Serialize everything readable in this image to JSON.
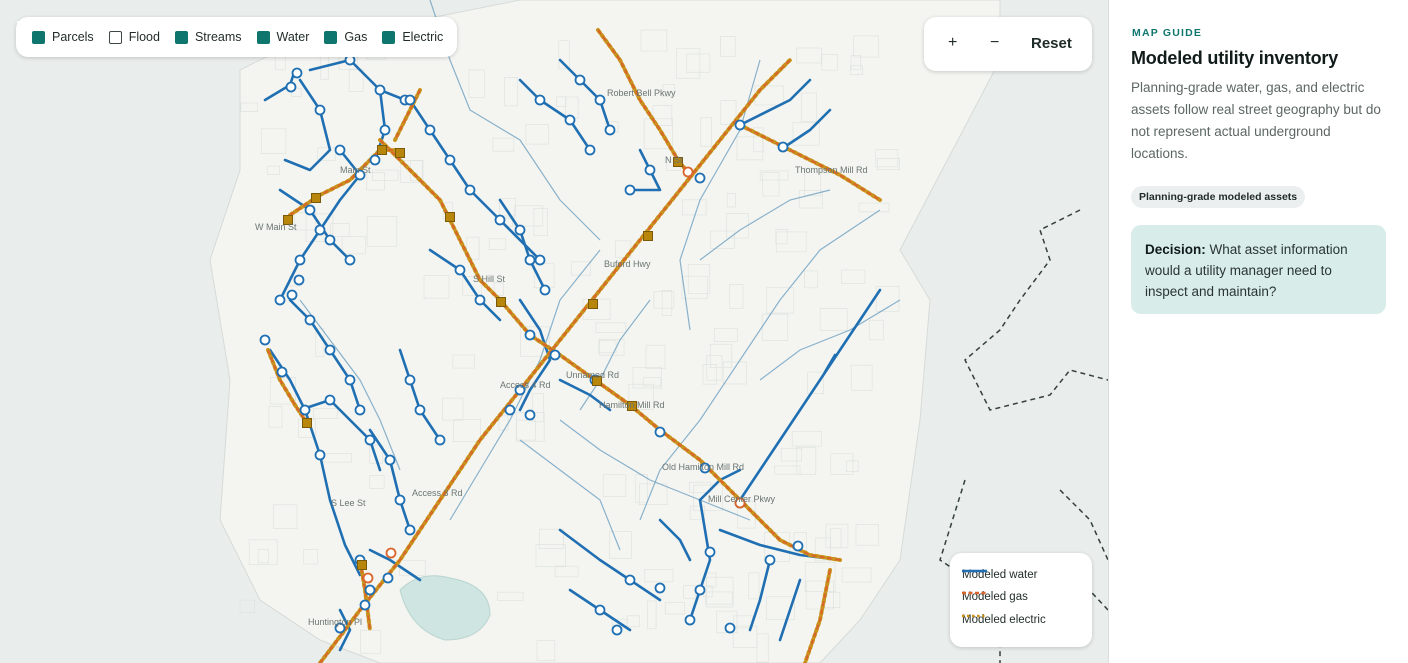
{
  "layers": [
    {
      "label": "Parcels",
      "checked": true
    },
    {
      "label": "Flood",
      "checked": false
    },
    {
      "label": "Streams",
      "checked": true
    },
    {
      "label": "Water",
      "checked": true
    },
    {
      "label": "Gas",
      "checked": true
    },
    {
      "label": "Electric",
      "checked": true
    }
  ],
  "zoom": {
    "in_label": "+",
    "out_label": "−",
    "reset_label": "Reset"
  },
  "legend": {
    "water": "Modeled water",
    "gas": "Modeled gas",
    "electric": "Modeled electric"
  },
  "map_labels": {
    "robert_bell": "Robert Bell Pkwy",
    "main_st": "Main St",
    "w_main": "W Main St",
    "n_st": "N St",
    "thompson": "Thompson Mill Rd",
    "buford": "Buford Hwy",
    "s_hill": "S Hill St",
    "access4": "Access 4 Rd",
    "unnamed": "Unnamed Rd",
    "hamilton": "Hamilton Mill Rd",
    "old_hamilton": "Old Hamilton Mill Rd",
    "mill_center": "Mill Center Pkwy",
    "s_lee": "S Lee St",
    "access3": "Access 3 Rd",
    "huntington": "Huntington Pl"
  },
  "colors": {
    "water": "#1f6fb2",
    "gas": "#d9652b",
    "electric": "#c8931a",
    "accent": "#0f766e",
    "stream": "#6fa0c0",
    "boundary": "#34403d"
  },
  "sidebar": {
    "eyebrow": "MAP GUIDE",
    "title": "Modeled utility inventory",
    "description": "Planning-grade water, gas, and electric assets follow real street geography but do not represent actual underground locations.",
    "badge": "Planning-grade modeled assets",
    "decision_label": "Decision:",
    "decision_text": "What asset information would a utility manager need to inspect and maintain?"
  }
}
